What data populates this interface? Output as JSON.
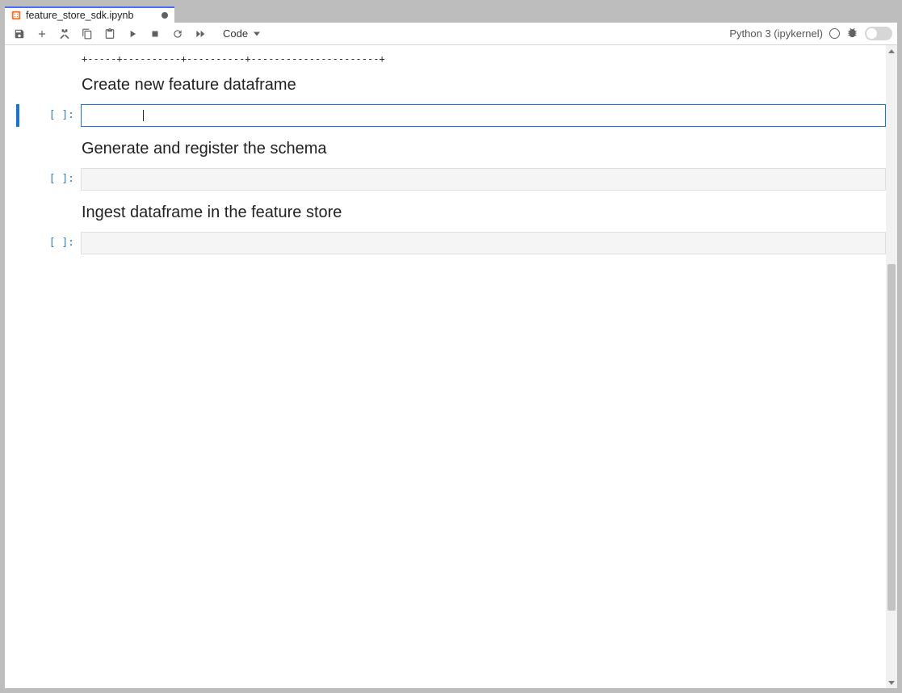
{
  "tab": {
    "filename": "feature_store_sdk.ipynb"
  },
  "toolbar": {
    "cell_type": "Code",
    "kernel_name": "Python 3 (ipykernel)"
  },
  "output_tail": "+-----+----------+----------+----------------------+",
  "headings": {
    "h1": "Create new feature dataframe",
    "h2": "Generate and register the schema",
    "h3": "Ingest dataframe in the feature store"
  },
  "prompts": {
    "empty": "[ ]:"
  },
  "scrollbar": {
    "thumb_top_pct": 34,
    "thumb_height_pct": 54
  }
}
